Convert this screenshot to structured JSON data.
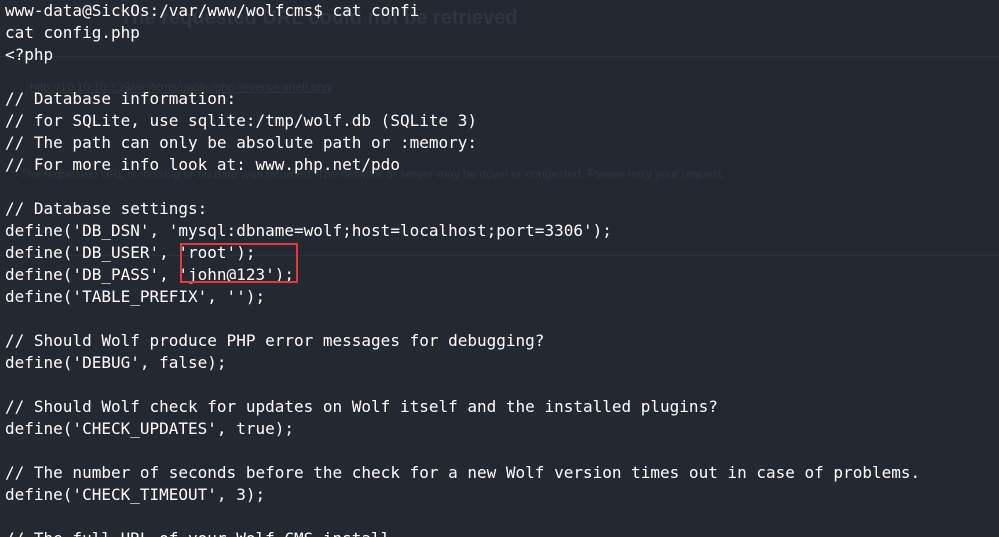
{
  "terminal": {
    "lines": [
      "www-data@SickOs:/var/www/wolfcms$ cat confi",
      "cat config.php",
      "<?php",
      "",
      "// Database information:",
      "// for SQLite, use sqlite:/tmp/wolf.db (SQLite 3)",
      "// The path can only be absolute path or :memory:",
      "// For more info look at: www.php.net/pdo",
      "",
      "// Database settings:",
      "define('DB_DSN', 'mysql:dbname=wolf;host=localhost;port=3306');",
      "define('DB_USER', 'root');",
      "define('DB_PASS', 'john@123');",
      "define('TABLE_PREFIX', '');",
      "",
      "// Should Wolf produce PHP error messages for debugging?",
      "define('DEBUG', false);",
      "",
      "// Should Wolf check for updates on Wolf itself and the installed plugins?",
      "define('CHECK_UPDATES', true);",
      "",
      "// The number of seconds before the check for a new Wolf version times out in case of problems.",
      "define('CHECK_TIMEOUT', 3);",
      "",
      "// The full URL of your Wolf CMS install"
    ]
  },
  "background_page": {
    "title": "The requested URL could not be retrieved",
    "url": "http://10.10.10.139/wolfcms/public/php-reverse-shell.php",
    "message": "The requested URL is missing or no data was returned. The network or server may be down or congested. Please retry your request."
  },
  "colors": {
    "background": "#232831",
    "text": "#ffffff",
    "highlight_border": "#e23b3b"
  }
}
